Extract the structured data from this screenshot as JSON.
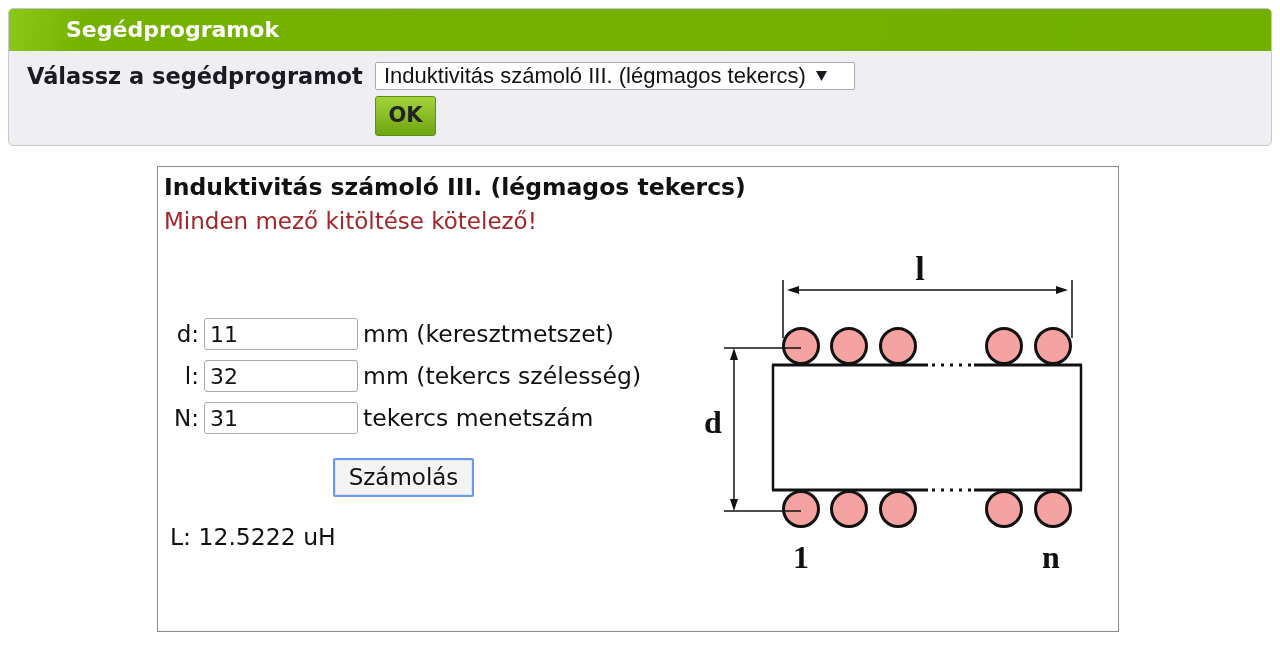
{
  "panel": {
    "title": "Segédprogramok",
    "select_label": "Válassz a segédprogramot",
    "select_value": "Induktivitás számoló III. (légmagos tekercs)",
    "ok_button": "OK"
  },
  "calculator": {
    "title": "Induktivitás számoló III. (légmagos tekercs)",
    "warning": "Minden mező kitöltése kötelező!",
    "fields": [
      {
        "label": "d:",
        "value": "11",
        "unit": "mm (keresztmetszet)"
      },
      {
        "label": "l:",
        "value": "32",
        "unit": "mm (tekercs szélesség)"
      },
      {
        "label": "N:",
        "value": "31",
        "unit": "tekercs menetszám"
      }
    ],
    "button": {
      "label": "Számolás",
      "focused": true
    },
    "result": "L: 12.5222 uH",
    "diagram": {
      "length_label": "l",
      "diameter_label": "d",
      "first_turn_label": "1",
      "last_turn_label": "n"
    }
  }
}
